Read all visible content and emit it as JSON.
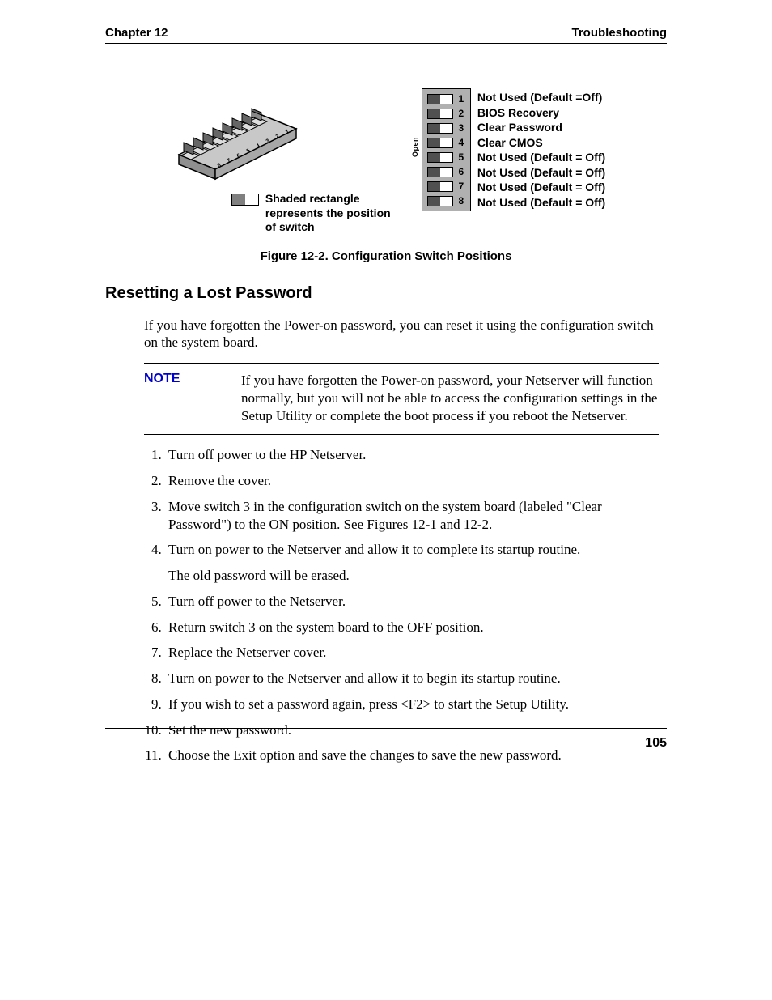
{
  "header": {
    "left": "Chapter 12",
    "right": "Troubleshooting"
  },
  "figure": {
    "legend": "Shaded rectangle represents the position of switch",
    "open_label": "Open",
    "switches": [
      {
        "num": "1",
        "label": "Not Used (Default =Off)"
      },
      {
        "num": "2",
        "label": "BIOS Recovery"
      },
      {
        "num": "3",
        "label": "Clear Password"
      },
      {
        "num": "4",
        "label": "Clear CMOS"
      },
      {
        "num": "5",
        "label": "Not Used (Default = Off)"
      },
      {
        "num": "6",
        "label": "Not Used (Default = Off)"
      },
      {
        "num": "7",
        "label": "Not Used (Default = Off)"
      },
      {
        "num": "8",
        "label": "Not Used (Default = Off)"
      }
    ],
    "caption": "Figure 12-2. Configuration Switch Positions"
  },
  "section_title": "Resetting a Lost Password",
  "intro": "If you have forgotten the Power-on password, you can reset it using the configuration switch on the system board.",
  "note": {
    "label": "NOTE",
    "text": "If you have forgotten the Power-on password, your Netserver will function normally, but you will not be able to access the configuration settings in the Setup Utility or complete the boot process if you reboot the Netserver."
  },
  "steps": [
    {
      "text": "Turn off power to the HP Netserver."
    },
    {
      "text": "Remove the cover."
    },
    {
      "text": "Move switch 3 in the configuration switch on the system board (labeled \"Clear Password\") to the ON position. See Figures 12-1 and 12-2."
    },
    {
      "text": "Turn on power to the Netserver and allow it to complete its startup routine.",
      "sub": "The old password will be erased."
    },
    {
      "text": "Turn off power to the Netserver."
    },
    {
      "text": "Return switch 3 on the system board to the OFF position."
    },
    {
      "text": "Replace the Netserver cover."
    },
    {
      "text": "Turn on power to the Netserver and allow it to begin its startup routine."
    },
    {
      "text": "If you wish to set a password again, press <F2> to start the Setup Utility."
    },
    {
      "text": "Set the new password."
    },
    {
      "text": "Choose the Exit option and save the changes to save the new password."
    }
  ],
  "page_number": "105"
}
